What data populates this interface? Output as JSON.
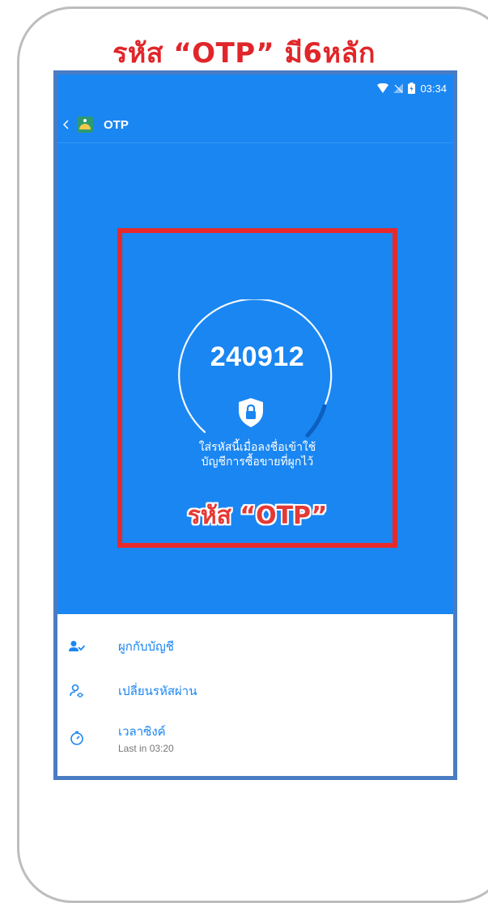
{
  "headline": "รหัส “OTP” มี6หลัก",
  "statusbar": {
    "time": "03:34",
    "wifi_icon": "wifi-icon",
    "signal_icon": "no-signal-icon",
    "battery_icon": "battery-icon"
  },
  "appbar": {
    "back_icon": "chevron-left-icon",
    "app_icon": "app-logo-icon",
    "title": "OTP"
  },
  "otp": {
    "code": "240912",
    "hint_line1": "ใส่รหัสนี้เมื่อลงชื่อเข้าใช้",
    "hint_line2": "บัญชีการซื้อขายที่ผูกไว้",
    "label": "รหัส “OTP”",
    "shield_icon": "shield-lock-icon"
  },
  "menu": {
    "items": [
      {
        "icon": "link-account-icon",
        "label": "ผูกกับบัญชี"
      },
      {
        "icon": "change-password-icon",
        "label": "เปลี่ยนรหัสผ่าน"
      },
      {
        "icon": "timer-sync-icon",
        "label": "เวลาซิงค์",
        "sub": "Last in 03:20"
      }
    ]
  },
  "colors": {
    "screen_bg": "#1a86f2",
    "highlight": "#e62a2c",
    "accent": "#1a86f2"
  }
}
